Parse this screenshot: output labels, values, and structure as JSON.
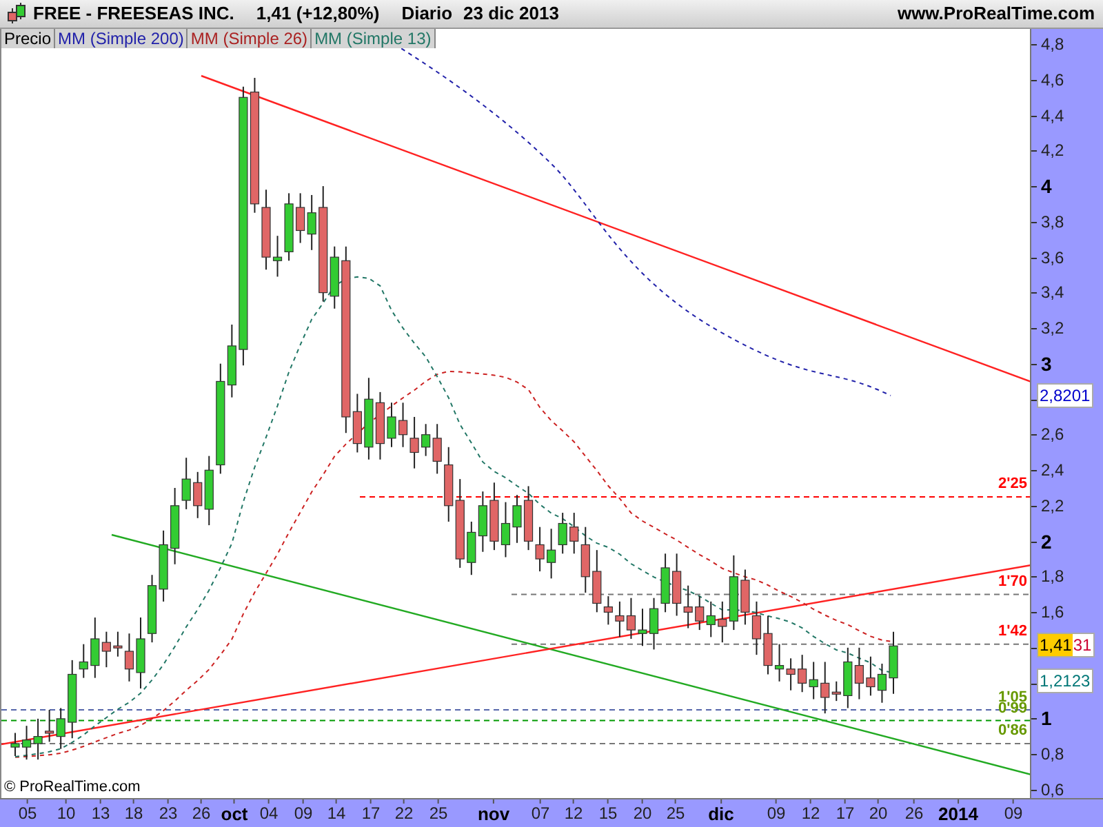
{
  "header": {
    "title": "FREE - FREESEAS INC.",
    "quote": "1,41 (+12,80%)",
    "period": "Diario",
    "date": "23 dic 2013",
    "site": "www.ProRealTime.com"
  },
  "legend": [
    {
      "label": "Precio",
      "color": "#000000"
    },
    {
      "label": "MM (Simple 200)",
      "color": "#2222aa"
    },
    {
      "label": "MM (Simple 26)",
      "color": "#aa2222"
    },
    {
      "label": "MM (Simple 13)",
      "color": "#227766"
    }
  ],
  "levels": [
    {
      "label": "2'25",
      "color": "#ff0000"
    },
    {
      "label": "1'70",
      "color": "#ff0000"
    },
    {
      "label": "1'42",
      "color": "#ff0000"
    },
    {
      "label": "1'05",
      "color": "#669900"
    },
    {
      "label": "0'99",
      "color": "#669900"
    },
    {
      "label": "0'86",
      "color": "#669900"
    }
  ],
  "price_tags": [
    {
      "kind": "plain",
      "text": "2,8201",
      "color": "#0000cc"
    },
    {
      "kind": "split",
      "highlight": "1,41",
      "text": "31",
      "color": "#cc0033"
    },
    {
      "kind": "plain",
      "text": "1,2123",
      "color": "#007777"
    }
  ],
  "copyright": "© ProRealTime.com",
  "y_axis": [
    {
      "label": "4,8",
      "kind": "minor"
    },
    {
      "label": "4,6",
      "kind": "minor"
    },
    {
      "label": "4,4",
      "kind": "minor"
    },
    {
      "label": "4,2",
      "kind": "minor"
    },
    {
      "label": "4",
      "kind": "major"
    },
    {
      "label": "3,8",
      "kind": "minor"
    },
    {
      "label": "3,6",
      "kind": "minor"
    },
    {
      "label": "3,4",
      "kind": "minor"
    },
    {
      "label": "3,2",
      "kind": "minor"
    },
    {
      "label": "3",
      "kind": "major"
    },
    {
      "label": "2,6",
      "kind": "minor"
    },
    {
      "label": "2,4",
      "kind": "minor"
    },
    {
      "label": "2,2",
      "kind": "minor"
    },
    {
      "label": "2",
      "kind": "major"
    },
    {
      "label": "1,8",
      "kind": "minor"
    },
    {
      "label": "1,6",
      "kind": "minor"
    },
    {
      "label": "1",
      "kind": "major"
    },
    {
      "label": "0,8",
      "kind": "minor"
    },
    {
      "label": "0,6",
      "kind": "minor"
    }
  ],
  "x_axis": [
    {
      "label": "05",
      "kind": "day"
    },
    {
      "label": "10",
      "kind": "day"
    },
    {
      "label": "13",
      "kind": "day"
    },
    {
      "label": "18",
      "kind": "day"
    },
    {
      "label": "23",
      "kind": "day"
    },
    {
      "label": "26",
      "kind": "day"
    },
    {
      "label": "oct",
      "kind": "month"
    },
    {
      "label": "04",
      "kind": "day"
    },
    {
      "label": "09",
      "kind": "day"
    },
    {
      "label": "14",
      "kind": "day"
    },
    {
      "label": "17",
      "kind": "day"
    },
    {
      "label": "22",
      "kind": "day"
    },
    {
      "label": "25",
      "kind": "day"
    },
    {
      "label": "nov",
      "kind": "month"
    },
    {
      "label": "07",
      "kind": "day"
    },
    {
      "label": "12",
      "kind": "day"
    },
    {
      "label": "15",
      "kind": "day"
    },
    {
      "label": "20",
      "kind": "day"
    },
    {
      "label": "25",
      "kind": "day"
    },
    {
      "label": "dic",
      "kind": "month"
    },
    {
      "label": "09",
      "kind": "day"
    },
    {
      "label": "12",
      "kind": "day"
    },
    {
      "label": "17",
      "kind": "day"
    },
    {
      "label": "20",
      "kind": "day"
    },
    {
      "label": "26",
      "kind": "day"
    },
    {
      "label": "2014",
      "kind": "month"
    },
    {
      "label": "09",
      "kind": "day"
    }
  ]
}
